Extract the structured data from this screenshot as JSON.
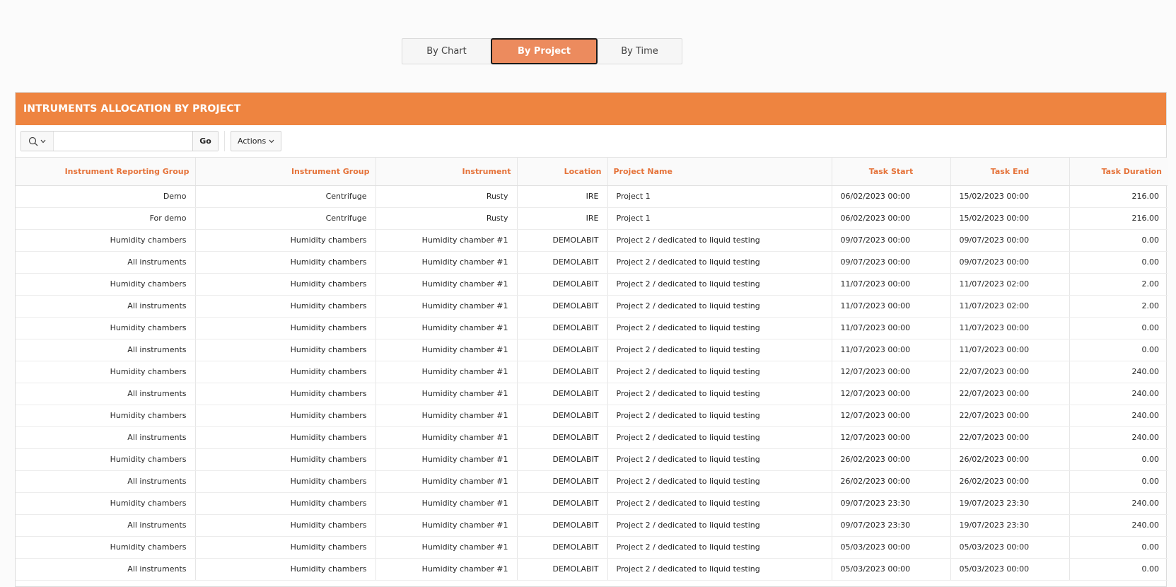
{
  "tabs": [
    {
      "label": "By Chart",
      "active": false
    },
    {
      "label": "By Project",
      "active": true
    },
    {
      "label": "By Time",
      "active": false
    }
  ],
  "region": {
    "title": "INTRUMENTS ALLOCATION BY PROJECT",
    "accent_color": "#ee8440"
  },
  "toolbar": {
    "search_icon": "search-icon",
    "search_value": "",
    "go_label": "Go",
    "actions_label": "Actions"
  },
  "table": {
    "headers": [
      "Instrument Reporting Group",
      "Instrument Group",
      "Instrument",
      "Location",
      "Project Name",
      "Task Start",
      "Task End",
      "Task Duration"
    ],
    "rows": [
      [
        "Demo",
        "Centrifuge",
        "Rusty",
        "IRE",
        "Project 1",
        "06/02/2023 00:00",
        "15/02/2023 00:00",
        "216.00"
      ],
      [
        "For demo",
        "Centrifuge",
        "Rusty",
        "IRE",
        "Project 1",
        "06/02/2023 00:00",
        "15/02/2023 00:00",
        "216.00"
      ],
      [
        "Humidity chambers",
        "Humidity chambers",
        "Humidity chamber #1",
        "DEMOLABIT",
        "Project 2 / dedicated to liquid testing",
        "09/07/2023 00:00",
        "09/07/2023 00:00",
        "0.00"
      ],
      [
        "All instruments",
        "Humidity chambers",
        "Humidity chamber #1",
        "DEMOLABIT",
        "Project 2 / dedicated to liquid testing",
        "09/07/2023 00:00",
        "09/07/2023 00:00",
        "0.00"
      ],
      [
        "Humidity chambers",
        "Humidity chambers",
        "Humidity chamber #1",
        "DEMOLABIT",
        "Project 2 / dedicated to liquid testing",
        "11/07/2023 00:00",
        "11/07/2023 02:00",
        "2.00"
      ],
      [
        "All instruments",
        "Humidity chambers",
        "Humidity chamber #1",
        "DEMOLABIT",
        "Project 2 / dedicated to liquid testing",
        "11/07/2023 00:00",
        "11/07/2023 02:00",
        "2.00"
      ],
      [
        "Humidity chambers",
        "Humidity chambers",
        "Humidity chamber #1",
        "DEMOLABIT",
        "Project 2 / dedicated to liquid testing",
        "11/07/2023 00:00",
        "11/07/2023 00:00",
        "0.00"
      ],
      [
        "All instruments",
        "Humidity chambers",
        "Humidity chamber #1",
        "DEMOLABIT",
        "Project 2 / dedicated to liquid testing",
        "11/07/2023 00:00",
        "11/07/2023 00:00",
        "0.00"
      ],
      [
        "Humidity chambers",
        "Humidity chambers",
        "Humidity chamber #1",
        "DEMOLABIT",
        "Project 2 / dedicated to liquid testing",
        "12/07/2023 00:00",
        "22/07/2023 00:00",
        "240.00"
      ],
      [
        "All instruments",
        "Humidity chambers",
        "Humidity chamber #1",
        "DEMOLABIT",
        "Project 2 / dedicated to liquid testing",
        "12/07/2023 00:00",
        "22/07/2023 00:00",
        "240.00"
      ],
      [
        "Humidity chambers",
        "Humidity chambers",
        "Humidity chamber #1",
        "DEMOLABIT",
        "Project 2 / dedicated to liquid testing",
        "12/07/2023 00:00",
        "22/07/2023 00:00",
        "240.00"
      ],
      [
        "All instruments",
        "Humidity chambers",
        "Humidity chamber #1",
        "DEMOLABIT",
        "Project 2 / dedicated to liquid testing",
        "12/07/2023 00:00",
        "22/07/2023 00:00",
        "240.00"
      ],
      [
        "Humidity chambers",
        "Humidity chambers",
        "Humidity chamber #1",
        "DEMOLABIT",
        "Project 2 / dedicated to liquid testing",
        "26/02/2023 00:00",
        "26/02/2023 00:00",
        "0.00"
      ],
      [
        "All instruments",
        "Humidity chambers",
        "Humidity chamber #1",
        "DEMOLABIT",
        "Project 2 / dedicated to liquid testing",
        "26/02/2023 00:00",
        "26/02/2023 00:00",
        "0.00"
      ],
      [
        "Humidity chambers",
        "Humidity chambers",
        "Humidity chamber #1",
        "DEMOLABIT",
        "Project 2 / dedicated to liquid testing",
        "09/07/2023 23:30",
        "19/07/2023 23:30",
        "240.00"
      ],
      [
        "All instruments",
        "Humidity chambers",
        "Humidity chamber #1",
        "DEMOLABIT",
        "Project 2 / dedicated to liquid testing",
        "09/07/2023 23:30",
        "19/07/2023 23:30",
        "240.00"
      ],
      [
        "Humidity chambers",
        "Humidity chambers",
        "Humidity chamber #1",
        "DEMOLABIT",
        "Project 2 / dedicated to liquid testing",
        "05/03/2023 00:00",
        "05/03/2023 00:00",
        "0.00"
      ],
      [
        "All instruments",
        "Humidity chambers",
        "Humidity chamber #1",
        "DEMOLABIT",
        "Project 2 / dedicated to liquid testing",
        "05/03/2023 00:00",
        "05/03/2023 00:00",
        "0.00"
      ]
    ]
  }
}
